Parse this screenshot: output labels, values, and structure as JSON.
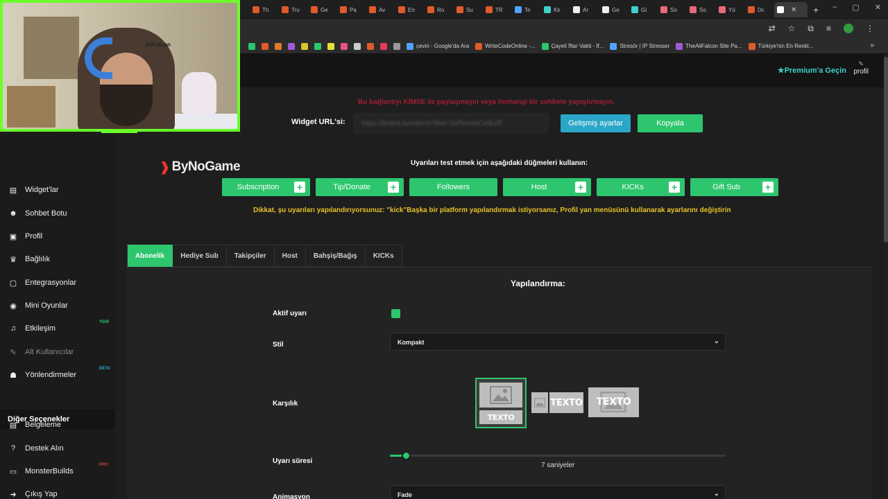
{
  "browser": {
    "tabs": [
      {
        "label": "Th",
        "color": "#e05a2b"
      },
      {
        "label": "Tru",
        "color": "#e05a2b"
      },
      {
        "label": "Ge",
        "color": "#e05a2b"
      },
      {
        "label": "Pa",
        "color": "#e05a2b"
      },
      {
        "label": "Av",
        "color": "#e05a2b"
      },
      {
        "label": "En",
        "color": "#e05a2b"
      },
      {
        "label": "Ro",
        "color": "#e05a2b"
      },
      {
        "label": "Su",
        "color": "#e05a2b"
      },
      {
        "label": "TR",
        "color": "#e05a2b"
      },
      {
        "label": "Te",
        "color": "#4fa3ff"
      },
      {
        "label": "Kir",
        "color": "#3fd0c8"
      },
      {
        "label": "Ar",
        "color": "#eeeeee"
      },
      {
        "label": "Ge",
        "color": "#eeeeee"
      },
      {
        "label": "Gi",
        "color": "#3fd0c8"
      },
      {
        "label": "So",
        "color": "#e86a7a"
      },
      {
        "label": "So",
        "color": "#e86a7a"
      },
      {
        "label": "Yü",
        "color": "#e86a7a"
      },
      {
        "label": "Dc",
        "color": "#e05a2b"
      },
      {
        "label": "",
        "color": "#ffffff"
      }
    ],
    "new_tab": "+",
    "tab_close": "✕",
    "window_controls": [
      "–",
      "▢",
      "✕"
    ],
    "bookmarks": [
      {
        "label": "",
        "color": "#2dc66e"
      },
      {
        "label": "",
        "color": "#e05a2b"
      },
      {
        "label": "",
        "color": "#e07b2b"
      },
      {
        "label": "",
        "color": "#a05ad8"
      },
      {
        "label": "",
        "color": "#d8c52b"
      },
      {
        "label": "",
        "color": "#2dc66e"
      },
      {
        "label": "",
        "color": "#e8e03a"
      },
      {
        "label": "",
        "color": "#e8528a"
      },
      {
        "label": "",
        "color": "#cccccc"
      },
      {
        "label": "",
        "color": "#e05a2b"
      },
      {
        "label": "",
        "color": "#e83a5a"
      },
      {
        "label": "",
        "color": "#999999"
      },
      {
        "label": "çeviri - Google'da Ara",
        "color": "#4fa3ff"
      },
      {
        "label": "WriteCodeOnline -...",
        "color": "#e05a2b"
      },
      {
        "label": "Çayeli İftar Vakti - İf...",
        "color": "#2dc66e"
      },
      {
        "label": "Stresör | IP Stresser",
        "color": "#4fa3ff"
      },
      {
        "label": "TheAliFalcon Site Pa...",
        "color": "#a05ad8"
      },
      {
        "label": "Türkiye'nin En Renkl...",
        "color": "#e05a2b"
      }
    ],
    "bookmarks_more": "»"
  },
  "topbar": {
    "premium": "★Premium'a Geçin",
    "profile": "profil"
  },
  "sidebar": {
    "items": [
      {
        "label": "Widget'lar",
        "icon": "▤"
      },
      {
        "label": "Sohbet Botu",
        "icon": "☻"
      },
      {
        "label": "Profil",
        "icon": "▣"
      },
      {
        "label": "Bağlılık",
        "icon": "♛"
      },
      {
        "label": "Entegrasyonlar",
        "icon": "▢"
      },
      {
        "label": "Mini Oyunlar",
        "icon": "◉"
      },
      {
        "label": "Etkileşim",
        "icon": "♫",
        "badge": "YENİ"
      },
      {
        "label": "Alt Kullanıcılar",
        "icon": "✎"
      },
      {
        "label": "Yönlendirmeler",
        "icon": "☗",
        "badge": "BETA"
      }
    ],
    "section_title": "Diğer Seçenekler",
    "other_items": [
      {
        "label": "Belgeleme",
        "icon": "▤"
      },
      {
        "label": "Destek Alın",
        "icon": "?"
      },
      {
        "label": "MonsterBuilds",
        "icon": "▭",
        "badge": "PRO"
      },
      {
        "label": "Çıkış Yap",
        "icon": "➜"
      }
    ]
  },
  "colors": {
    "accent_green": "#2dc66e",
    "accent_cyan": "#2aa6c8",
    "warning_red": "#a01f33",
    "notice_yellow": "#e7c125",
    "badge_new": "#2dc66e",
    "badge_beta": "#2aa6c8",
    "badge_pro": "#d23a3a"
  },
  "main": {
    "warning": "Bu bağlantıyı KİMSE ile paylaşmayın veya herhangi bir sohbete yapıştırmayın.",
    "widget_url_label": "Widget URL'si:",
    "widget_url_value": "https://bottra.live/alerts?tkid=5cPbcHaCx9k2ff",
    "advanced_button": "Gelişmiş ayarlar",
    "copy_button": "Kopyala",
    "logo_text": "ByNoGame",
    "test_label": "Uyarıları test etmek için aşağıdaki düğmeleri kullanın:",
    "test_buttons": [
      {
        "label": "Subscription",
        "plus": true
      },
      {
        "label": "Tip/Donate",
        "plus": true
      },
      {
        "label": "Followers",
        "plus": false
      },
      {
        "label": "Host",
        "plus": true
      },
      {
        "label": "KICKs",
        "plus": true
      },
      {
        "label": "Gift Sub",
        "plus": true
      }
    ],
    "notice": "Dikkat, şu uyarıları yapılandırıyorsunuz: \"kick\"Başka bir platform yapılandırmak istiyorsanız, Profil yan menüsünü kullanarak ayarlarını değiştirin",
    "tabs": [
      "Abonelik",
      "Hediye Sub",
      "Takipçiler",
      "Host",
      "Bahşiş/Bağış",
      "KICKs"
    ],
    "active_tab": "Abonelik",
    "config": {
      "title": "Yapılandırma:",
      "active_label": "Aktif uyarı",
      "active_checked": true,
      "style_label": "Stil",
      "style_value": "Kompakt",
      "layout_label": "Karşılık",
      "layout_texto": "TEXTO",
      "duration_label": "Uyarı süresi",
      "duration_fraction": 0.05,
      "duration_value": "7 saniyeler",
      "animation_label": "Animasyon",
      "animation_value": "Fade"
    }
  },
  "webcam": {
    "tag": "AliFalcon"
  }
}
